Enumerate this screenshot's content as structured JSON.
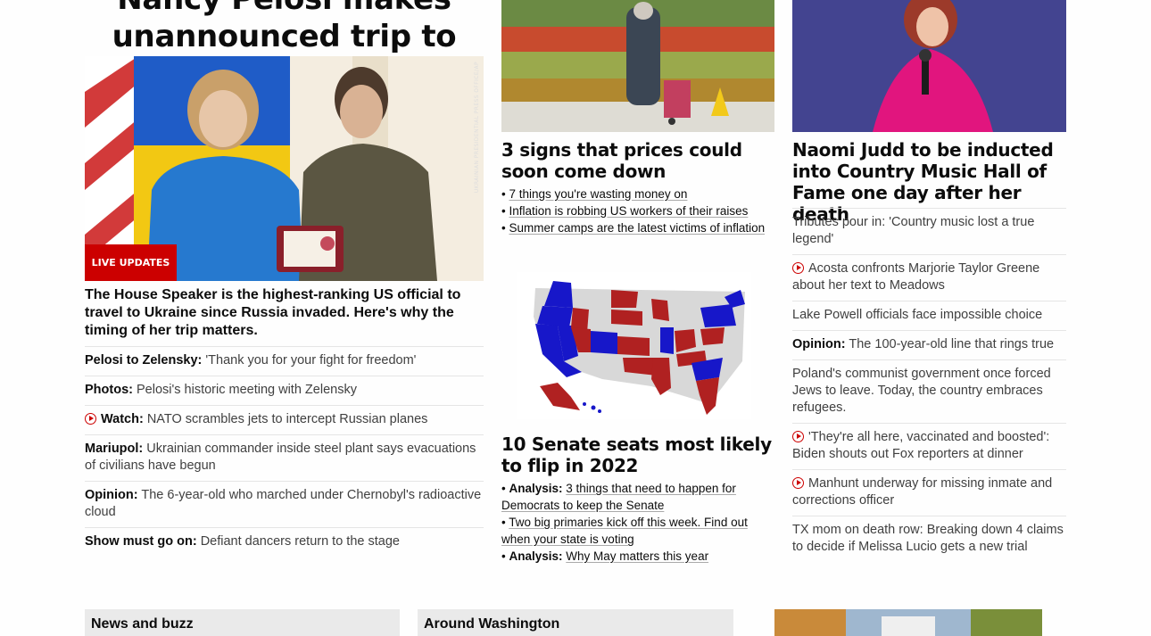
{
  "lead": {
    "headline": "Nancy Pelosi makes unannounced trip to Kyiv",
    "photo_credit": "UKRAINIAN PRESIDENTIAL PRESS OFFICE/AP",
    "badge": "LIVE UPDATES",
    "subhead": "The House Speaker is the highest-ranking US official to travel to Ukraine since Russia invaded. Here's why the timing of her trip matters.",
    "items": [
      {
        "label": "Pelosi to Zelensky:",
        "text": "'Thank you for your fight for freedom'",
        "icon": ""
      },
      {
        "label": "Photos:",
        "text": "Pelosi's historic meeting with Zelensky",
        "icon": ""
      },
      {
        "label": "Watch:",
        "text": "NATO scrambles jets to intercept Russian planes",
        "icon": "play-icon"
      },
      {
        "label": "Mariupol:",
        "text": "Ukrainian commander inside steel plant says evacuations of civilians have begun",
        "icon": ""
      },
      {
        "label": "Opinion:",
        "text": "The 6-year-old who marched under Chernobyl's radioactive cloud",
        "icon": ""
      },
      {
        "label": "Show must go on:",
        "text": "Defiant dancers return to the stage",
        "icon": ""
      }
    ]
  },
  "prices": {
    "title": "3 signs that prices could soon come down",
    "bullets": [
      {
        "label": "",
        "text": "7 things you're wasting money on"
      },
      {
        "label": "",
        "text": "Inflation is robbing US workers of their raises"
      },
      {
        "label": "",
        "text": "Summer camps are the latest victims of inflation"
      }
    ]
  },
  "senate": {
    "title": "10 Senate seats most likely to flip in 2022",
    "bullets": [
      {
        "label": "Analysis:",
        "text": "3 things that need to happen for Democrats to keep the Senate"
      },
      {
        "label": "",
        "text": "Two big primaries kick off this week. Find out when your state is voting"
      },
      {
        "label": "Analysis:",
        "text": "Why May matters this year"
      }
    ]
  },
  "judd": {
    "title": "Naomi Judd to be inducted into Country Music Hall of Fame one day after her death",
    "items": [
      {
        "label": "",
        "text": "Tributes pour in: 'Country music lost a true legend'",
        "icon": ""
      },
      {
        "label": "",
        "text": "Acosta confronts Marjorie Taylor Greene about her text to Meadows",
        "icon": "play-icon"
      },
      {
        "label": "",
        "text": "Lake Powell officials face impossible choice",
        "icon": ""
      },
      {
        "label": "Opinion:",
        "text": "The 100-year-old line that rings true",
        "icon": ""
      },
      {
        "label": "",
        "text": "Poland's communist government once forced Jews to leave. Today, the country embraces refugees.",
        "icon": ""
      },
      {
        "label": "",
        "text": "'They're all here, vaccinated and boosted': Biden shouts out Fox reporters at dinner",
        "icon": "play-icon"
      },
      {
        "label": "",
        "text": "Manhunt underway for missing inmate and corrections officer",
        "icon": "play-icon"
      },
      {
        "label": "",
        "text": "TX mom on death row: Breaking down 4 claims to decide if Melissa Lucio gets a new trial",
        "icon": ""
      }
    ]
  },
  "sections": {
    "news_buzz": "News and buzz",
    "around_washington": "Around Washington"
  },
  "colors": {
    "accent": "#cc0000",
    "dem": "#1717c9",
    "rep": "#b02121",
    "neutral": "#d7d7d7"
  }
}
